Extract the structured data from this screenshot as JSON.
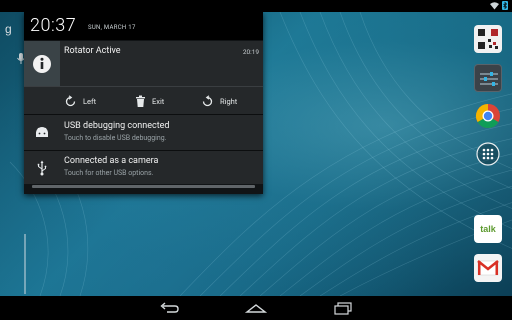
{
  "status_bar": {
    "icons": [
      "wifi-icon",
      "bluetooth-icon"
    ]
  },
  "shade": {
    "time": "20:37",
    "date": "SUN, MARCH 17"
  },
  "notifications": [
    {
      "title": "Rotator Active",
      "time": "20:19",
      "icon": "info-icon",
      "actions": [
        {
          "label": "Left",
          "icon": "rotate-left-icon"
        },
        {
          "label": "Exit",
          "icon": "trash-icon"
        },
        {
          "label": "Right",
          "icon": "rotate-right-icon"
        }
      ]
    },
    {
      "title": "USB debugging connected",
      "subtitle": "Touch to disable USB debugging.",
      "icon": "android-icon"
    },
    {
      "title": "Connected as a camera",
      "subtitle": "Touch for other USB options.",
      "icon": "usb-icon"
    }
  ],
  "dock": {
    "apps": [
      "qr-scanner-icon",
      "settings-sliders-icon",
      "chrome-icon",
      "all-apps-icon",
      "talk-icon",
      "gmail-icon"
    ],
    "talk_label": "talk"
  },
  "navigation": {
    "buttons": [
      "back-icon",
      "home-icon",
      "recent-apps-icon"
    ]
  },
  "colors": {
    "shade_bg": "#111416",
    "notification_bg": "#25282a",
    "wallpaper": "#146681",
    "status_icon": "#33b5e5"
  }
}
